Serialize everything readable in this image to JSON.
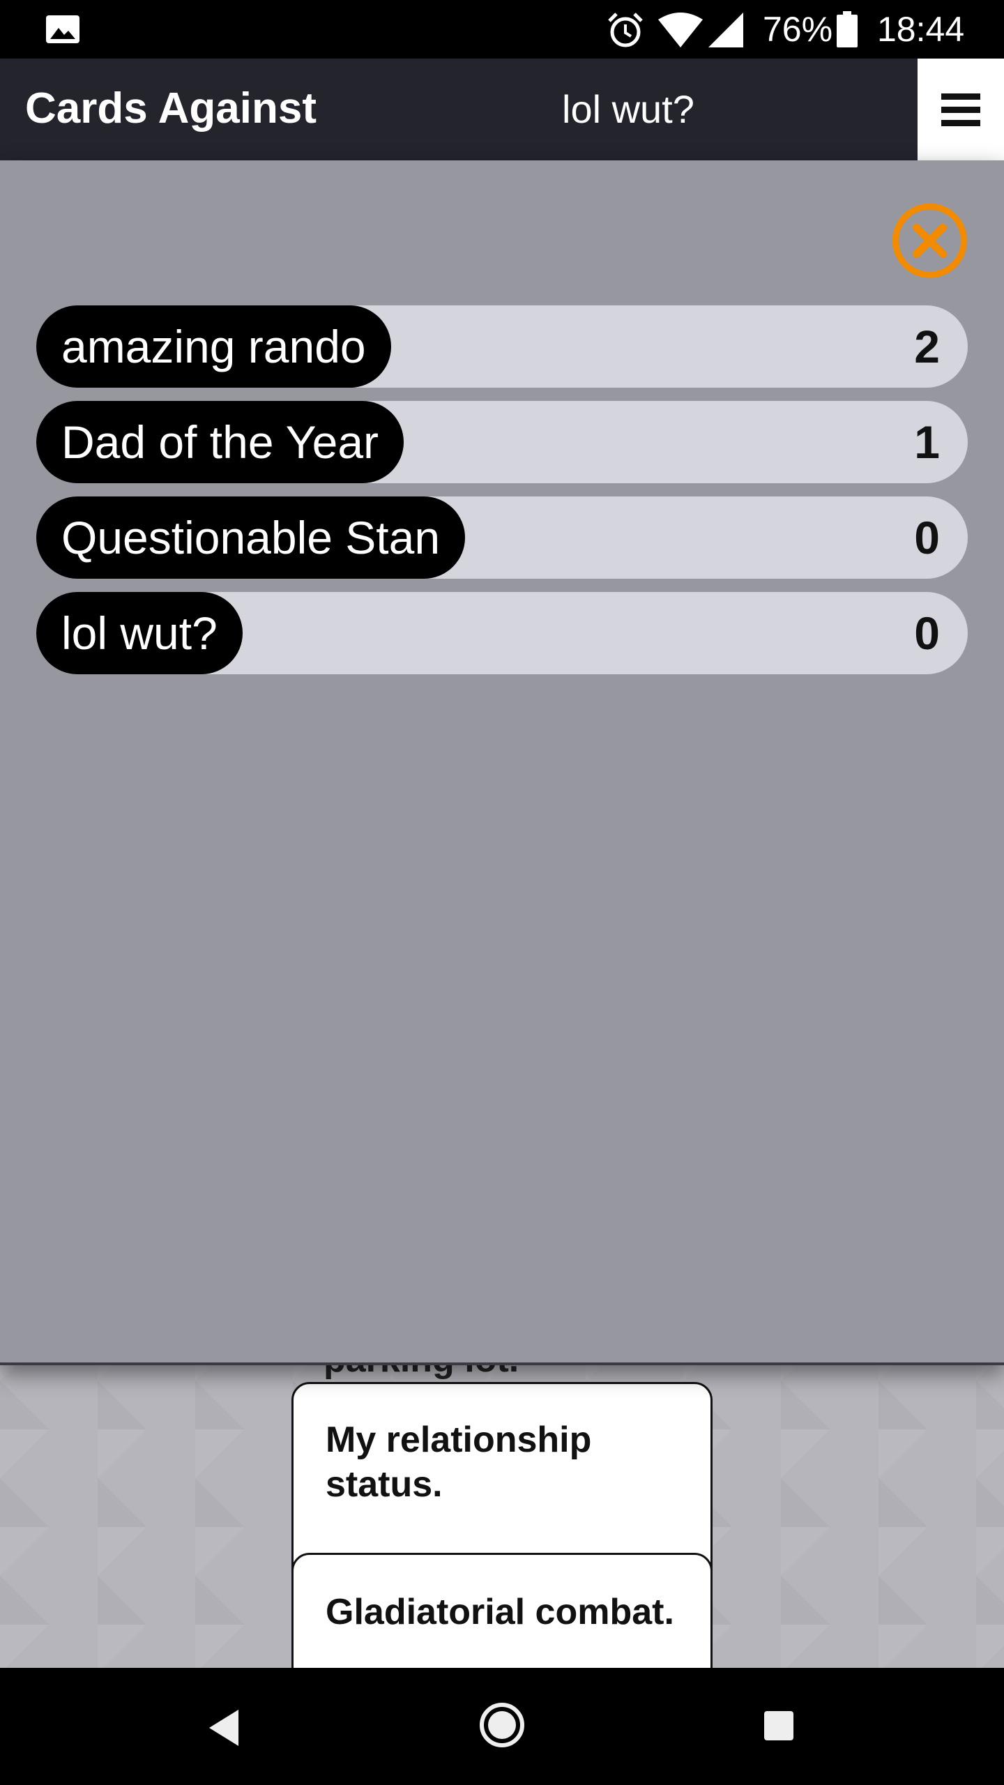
{
  "status_bar": {
    "battery_percent": "76%",
    "time": "18:44",
    "icons": [
      "gallery-icon",
      "alarm-icon",
      "wifi-icon",
      "signal-icon",
      "battery-icon"
    ]
  },
  "header": {
    "app_title": "Cards Against",
    "player_name": "lol wut?",
    "menu_icon": "hamburger-menu-icon"
  },
  "scoreboard": {
    "close_icon": "close-circle-icon",
    "accent_color": "#f28b00",
    "players": [
      {
        "name": "amazing rando",
        "score": "2"
      },
      {
        "name": "Dad of the Year",
        "score": "1"
      },
      {
        "name": "Questionable Stan",
        "score": "0"
      },
      {
        "name": "lol wut?",
        "score": "0"
      }
    ]
  },
  "cards": {
    "partial_text": "parking lot.",
    "items": [
      {
        "text": "My relationship status."
      },
      {
        "text": "Gladiatorial combat."
      }
    ]
  },
  "nav_bar": {
    "icons": [
      "back-icon",
      "home-icon",
      "recent-apps-icon"
    ]
  }
}
